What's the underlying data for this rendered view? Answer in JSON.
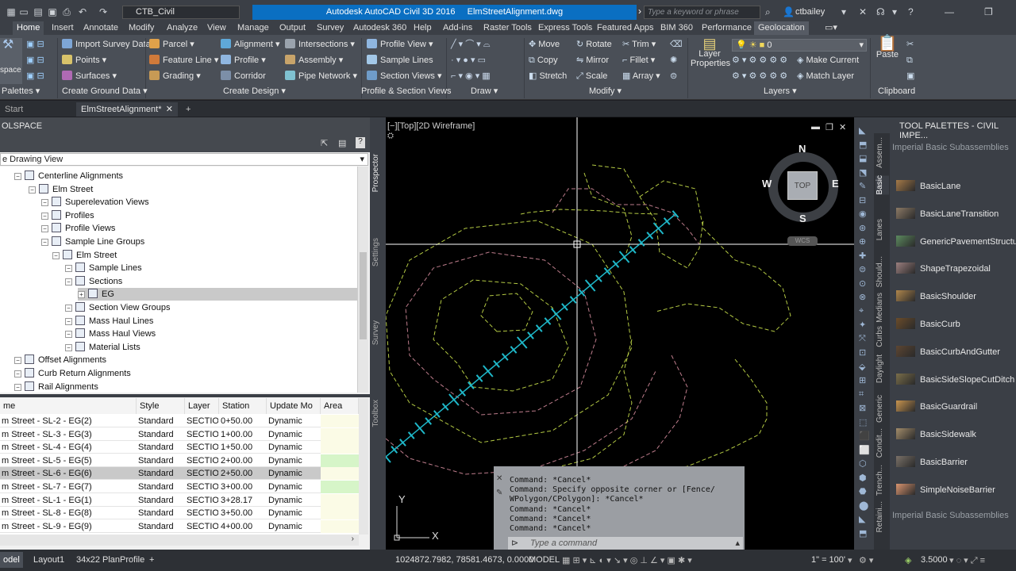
{
  "window": {
    "title_app": "Autodesk AutoCAD Civil 3D 2016",
    "title_doc": "ElmStreetAlignment.dwg",
    "workspace": "CTB_Civil",
    "search_placeholder": "Type a keyword or phrase",
    "user": "ctbailey"
  },
  "ribbon_tabs": [
    "Home",
    "Insert",
    "Annotate",
    "Modify",
    "Analyze",
    "View",
    "Manage",
    "Output",
    "Survey",
    "Autodesk 360",
    "Help",
    "Add-ins",
    "Raster Tools",
    "Express Tools",
    "Featured Apps",
    "BIM 360",
    "Performance",
    "Geolocation"
  ],
  "ribbon": {
    "toolspace": "space",
    "palettes": "Palettes",
    "import_survey": "Import Survey Data",
    "points": "Points",
    "surfaces": "Surfaces",
    "parcel": "Parcel",
    "feature_line": "Feature Line",
    "grading": "Grading",
    "alignment": "Alignment",
    "profile": "Profile",
    "corridor": "Corridor",
    "intersections": "Intersections",
    "assembly": "Assembly",
    "pipe_network": "Pipe Network",
    "profile_view": "Profile View",
    "sample_lines": "Sample Lines",
    "section_views": "Section Views",
    "move": "Move",
    "copy": "Copy",
    "stretch": "Stretch",
    "rotate": "Rotate",
    "mirror": "Mirror",
    "scale": "Scale",
    "trim": "Trim",
    "fillet": "Fillet",
    "array": "Array",
    "layer_properties": "Layer Properties",
    "layer_value": "0",
    "make_current": "Make Current",
    "match_layer": "Match Layer",
    "paste": "Paste",
    "panels": {
      "create_ground": "Create Ground Data",
      "create_design": "Create Design",
      "profile_section": "Profile & Section Views",
      "draw": "Draw",
      "modify": "Modify",
      "layers": "Layers",
      "clipboard": "Clipboard"
    }
  },
  "doc_tabs": {
    "start": "Start",
    "active": "ElmStreetAlignment*"
  },
  "toolspace": {
    "title": "OLSPACE",
    "view": "e Drawing View",
    "tree": [
      {
        "label": "Centerline Alignments",
        "indent": 1
      },
      {
        "label": "Elm Street",
        "indent": 2
      },
      {
        "label": "Superelevation Views",
        "indent": 3
      },
      {
        "label": "Profiles",
        "indent": 3
      },
      {
        "label": "Profile Views",
        "indent": 3
      },
      {
        "label": "Sample Line Groups",
        "indent": 3
      },
      {
        "label": "Elm Street",
        "indent": 4
      },
      {
        "label": "Sample Lines",
        "indent": 5
      },
      {
        "label": "Sections",
        "indent": 5
      },
      {
        "label": "EG",
        "indent": 6
      },
      {
        "label": "Section View Groups",
        "indent": 5
      },
      {
        "label": "Mass Haul Lines",
        "indent": 5
      },
      {
        "label": "Mass Haul Views",
        "indent": 5
      },
      {
        "label": "Material Lists",
        "indent": 5
      },
      {
        "label": "Offset Alignments",
        "indent": 1
      },
      {
        "label": "Curb Return Alignments",
        "indent": 1
      },
      {
        "label": "Rail Alignments",
        "indent": 1
      }
    ],
    "columns": [
      "me",
      "Style",
      "Layer",
      "Station",
      "Update Mo",
      "Area"
    ],
    "rows": [
      [
        "m Street - SL-2 - EG(2)",
        "Standard",
        "SECTIOI",
        "0+50.00",
        "Dynamic"
      ],
      [
        "m Street - SL-3 - EG(3)",
        "Standard",
        "SECTIOI",
        "1+00.00",
        "Dynamic"
      ],
      [
        "m Street - SL-4 - EG(4)",
        "Standard",
        "SECTIOI",
        "1+50.00",
        "Dynamic"
      ],
      [
        "m Street - SL-5 - EG(5)",
        "Standard",
        "SECTIOI",
        "2+00.00",
        "Dynamic"
      ],
      [
        "m Street - SL-6 - EG(6)",
        "Standard",
        "SECTIOI",
        "2+50.00",
        "Dynamic"
      ],
      [
        "m Street - SL-7 - EG(7)",
        "Standard",
        "SECTIOI",
        "3+00.00",
        "Dynamic"
      ],
      [
        "m Street - SL-1 - EG(1)",
        "Standard",
        "SECTIOI",
        "3+28.17",
        "Dynamic"
      ],
      [
        "m Street - SL-8 - EG(8)",
        "Standard",
        "SECTIOI",
        "3+50.00",
        "Dynamic"
      ],
      [
        "m Street - SL-9 - EG(9)",
        "Standard",
        "SECTIOI",
        "4+00.00",
        "Dynamic"
      ]
    ],
    "side_tabs": [
      "Prospector",
      "Settings",
      "Survey",
      "Toolbox"
    ]
  },
  "viewport": {
    "label": "[−][Top][2D Wireframe]",
    "viewcube": {
      "n": "N",
      "s": "S",
      "e": "E",
      "w": "W",
      "top": "TOP",
      "wcs": "WCS"
    },
    "ucs_x": "X",
    "ucs_y": "Y"
  },
  "command": {
    "history": [
      "Command: *Cancel*",
      "Command: Specify opposite corner or [Fence/",
      "WPolygon/CPolygon]: *Cancel*",
      "Command: *Cancel*",
      "Command: *Cancel*",
      "Command: *Cancel*"
    ],
    "placeholder": "Type a command"
  },
  "palette": {
    "title": "TOOL PALETTES - CIVIL IMPE...",
    "header": "Imperial Basic Subassemblies",
    "footer": "Imperial Basic Subassemblies",
    "items": [
      "BasicLane",
      "BasicLaneTransition",
      "GenericPavementStructure",
      "ShapeTrapezoidal",
      "BasicShoulder",
      "BasicCurb",
      "BasicCurbAndGutter",
      "BasicSideSlopeCutDitch",
      "BasicGuardrail",
      "BasicSidewalk",
      "BasicBarrier",
      "SimpleNoiseBarrier"
    ],
    "tabs": [
      "Assem...",
      "Basic",
      "Lanes",
      "Should...",
      "Medians",
      "Curbs",
      "Daylight",
      "Generic",
      "Condit...",
      "Trench...",
      "Retaini..."
    ]
  },
  "layout_tabs": [
    "odel",
    "Layout1",
    "34x22 PlanProfile"
  ],
  "status": {
    "coords": "1024872.7982, 78581.4673, 0.0000",
    "space": "MODEL",
    "scale": "1\" = 100'",
    "elevation": "3.5000"
  },
  "colors": {
    "accent": "#0a6fc2",
    "contour": "#c8e04a",
    "alignment": "#1fb8c9",
    "selected_row": "#c9c9c9",
    "green_cell": "#d6f5c8"
  }
}
